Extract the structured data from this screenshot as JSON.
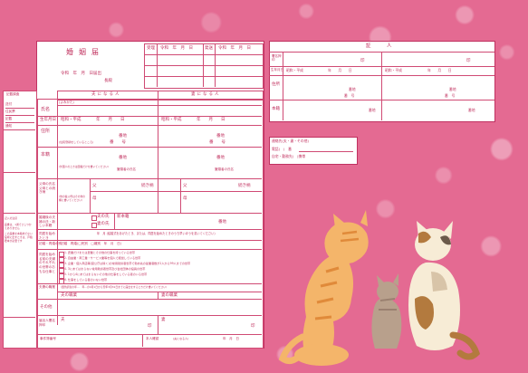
{
  "form": {
    "title": "婚姻届",
    "receipt": {
      "label_date": "令和",
      "label_nen": "年",
      "label_tsuki": "月",
      "label_hi": "日",
      "label_juri": "受理",
      "label_hassou": "発送"
    },
    "sub_header": {
      "date_line": "令和　年　月　日届出",
      "addressee": "長殿",
      "seal_label": "(印)"
    },
    "columns": {
      "husband": "夫になる人",
      "wife": "妻になる人"
    },
    "rows": {
      "name": "氏名",
      "furigana": "(よみかた)",
      "birthdate": "生年月日",
      "birth_era": "昭和・平成",
      "nen": "年",
      "tsuki": "月",
      "hi": "日",
      "address": "住所",
      "address_note": "(住民登録をしているところ)",
      "banchi": "番地",
      "ban": "番",
      "gou": "号",
      "honseki": "本籍",
      "honseki_note": "(外国人のときは国籍だけを書いてください)",
      "hittousha": "筆頭者の氏名",
      "parents": "父母の氏名 父母との続き柄",
      "parents_note": "(他の養父母はその他の欄に書いてください)",
      "father": "父",
      "mother": "母",
      "tsuzuki": "続き柄",
      "new_surname": "婚姻後の夫婦の氏・新しい本籍",
      "shin_honseki": "新本籍",
      "surname_opts": [
        "夫の氏",
        "妻の氏"
      ],
      "cohabit_start": "同居を始めたとき",
      "cohabit_date": "年　月 (結婚式をあげたとき、または、同居を始めたときのうち早いほうを書いてください)",
      "marriage_count": "初婚・再婚の別",
      "marriage_opts": "初婚　再婚(□死別　□離別　年　月　日)",
      "household": "同居を始める前の夫婦のそれぞれの世帯のおもな仕事と",
      "household_opts": [
        "1. 農業だけまたは農業とその他の仕事を持っている世帯",
        "2. 自由業・商工業・サービス業等を個人で経営している世帯",
        "3. 企業・個人商店等(官公庁は除く)の常用勤労者世帯で勤め先の従業者数が1人から99人までの世帯",
        "4. 3にあてはまらない常用勤労者世帯及び会社団体の役員の世帯",
        "5. 1から4にあてはまらないその他の仕事をしている者のいる世帯",
        "6. 仕事をしている者のいない世帯"
      ],
      "occupation": "夫妻の職業",
      "occupation_note": "(国勢調査の年…　年…の4月1日から翌年3月31日までに届出をするときだけ書いてください)",
      "husband_job": "夫の職業",
      "wife_job": "妻の職業",
      "other": "その他",
      "signature": "届出人署名押印",
      "sig_husband": "夫",
      "sig_wife": "妻",
      "in": "印",
      "contact": "事件簿番号"
    },
    "left_margin": {
      "stamp_title": "記載調査",
      "items": [
        "送付",
        "住民票",
        "記載",
        "通知"
      ],
      "checklist": [
        "記入の注意",
        "届書は、1通でさしつかえありません",
        "この届書を本籍地でない役場に出すときは、戸籍謄本が必要です"
      ]
    },
    "footer": {
      "id_label": "本人確認",
      "id_note": "(夫になる人)",
      "date_label": "年　月　日"
    }
  },
  "witness": {
    "title": "証　人",
    "rows": {
      "signature": "署名押印",
      "seal": "印",
      "birthdate": "生年月日",
      "birth_era": "昭和・平成",
      "nen": "年",
      "tsuki": "月",
      "hi": "日",
      "address": "住所",
      "banchi": "番地",
      "ban": "番",
      "gou": "号",
      "honseki": "本籍"
    }
  },
  "contact_box": {
    "title": "連絡先(夫・妻・その他)",
    "phone": "電話(　)　番",
    "home": "自宅・勤務先(　)携帯"
  }
}
